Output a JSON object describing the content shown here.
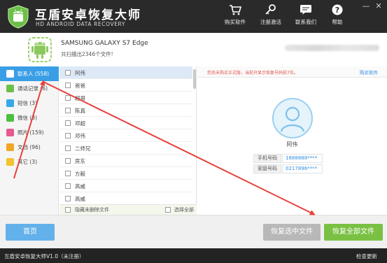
{
  "app": {
    "title": "互盾安卓恢复大师",
    "subtitle": "HD ANDROID DATA RECOVERY"
  },
  "toolbar": {
    "buy_label": "购买软件",
    "register_label": "注册激活",
    "contact_label": "联系我们",
    "help_label": "帮助",
    "minimize": "—",
    "close": "✕"
  },
  "device": {
    "name": "SAMSUNG GALAXY S7 Edge",
    "scan_summary": "共扫描出2346个文件!"
  },
  "categories": [
    {
      "label": "联系人 (558)",
      "icon": "contacts-icon",
      "color": "#3a9ee6"
    },
    {
      "label": "通话记录 (6)",
      "icon": "call-log-icon",
      "color": "#6cc04a"
    },
    {
      "label": "短信 (3)",
      "icon": "sms-icon",
      "color": "#38a8e8"
    },
    {
      "label": "微信 (3)",
      "icon": "wechat-icon",
      "color": "#4cbf3f"
    },
    {
      "label": "照片 (159)",
      "icon": "photo-icon",
      "color": "#e65a8f"
    },
    {
      "label": "文档 (96)",
      "icon": "document-icon",
      "color": "#f1a626"
    },
    {
      "label": "其它 (3)",
      "icon": "other-icon",
      "color": "#f2c230"
    }
  ],
  "file_list": {
    "rows": [
      "阿伟",
      "爸爸",
      "超哥",
      "陈真",
      "邓超",
      "邓伟",
      "二师兄",
      "房东",
      "方毅",
      "高威",
      "高威"
    ],
    "hide_deleted_label": "隐藏未删除文件",
    "select_all_label": "选择全部"
  },
  "detail": {
    "notice": "您尚未购买正式版，当前只显示恢复号码前7位。",
    "buy_link": "购买软件",
    "contact_name": "阿伟",
    "fields": [
      {
        "label": "手机号码",
        "value": "1888888****"
      },
      {
        "label": "家庭号码",
        "value": "0217896****"
      }
    ]
  },
  "actions": {
    "home": "首页",
    "recover_selected": "恢复选中文件",
    "recover_all": "恢复全部文件"
  },
  "status": {
    "left": "互盾安卓恢复大师V1.0（未注册）",
    "right": "检查更新"
  },
  "colors": {
    "accent": "#3a9ee6",
    "recover_all": "#7ac143",
    "arrow": "#e8403a"
  }
}
